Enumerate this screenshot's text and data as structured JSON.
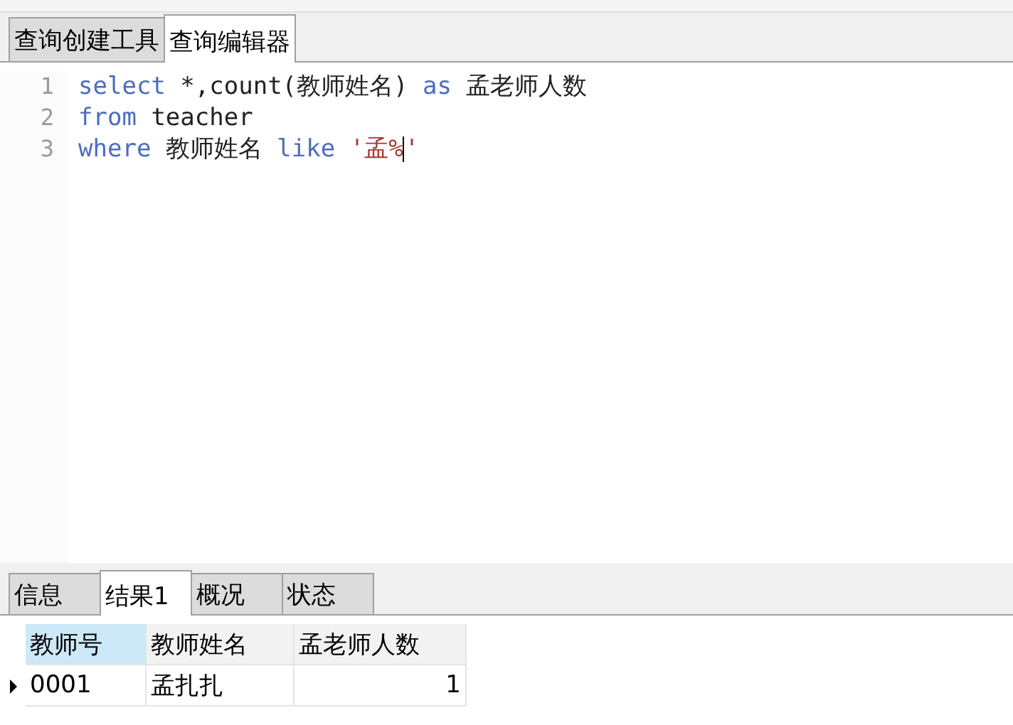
{
  "tabs": [
    {
      "label": "查询创建工具",
      "selected": false
    },
    {
      "label": "查询编辑器",
      "selected": true
    }
  ],
  "editor": {
    "lines": [
      {
        "number": "1",
        "tokens": [
          {
            "kind": "keyword",
            "text": "select"
          },
          {
            "kind": "plain",
            "text": " *,count(教师姓名) "
          },
          {
            "kind": "keyword",
            "text": "as"
          },
          {
            "kind": "plain",
            "text": " 孟老师人数"
          }
        ]
      },
      {
        "number": "2",
        "tokens": [
          {
            "kind": "keyword",
            "text": "from"
          },
          {
            "kind": "plain",
            "text": " teacher"
          }
        ]
      },
      {
        "number": "3",
        "tokens": [
          {
            "kind": "keyword",
            "text": "where"
          },
          {
            "kind": "plain",
            "text": " 教师姓名 "
          },
          {
            "kind": "keyword",
            "text": "like "
          },
          {
            "kind": "string",
            "text": "'孟%",
            "caret_after": true
          },
          {
            "kind": "string",
            "text": "'"
          }
        ]
      }
    ]
  },
  "result_tabs": [
    {
      "label": "信息",
      "selected": false
    },
    {
      "label": "结果1",
      "selected": true
    },
    {
      "label": "概况",
      "selected": false
    },
    {
      "label": "状态",
      "selected": false
    }
  ],
  "table": {
    "columns": [
      {
        "label": "教师号",
        "kind": "text",
        "selected": true
      },
      {
        "label": "教师姓名",
        "kind": "text",
        "selected": false
      },
      {
        "label": "孟老师人数",
        "kind": "number",
        "selected": false
      }
    ],
    "rows": [
      {
        "current": true,
        "cells": [
          "0001",
          "孟扎扎",
          "1"
        ]
      }
    ]
  }
}
